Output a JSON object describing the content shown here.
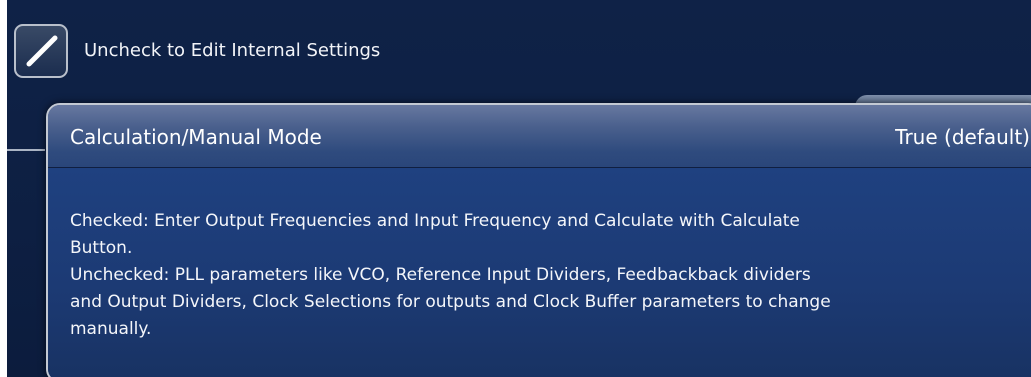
{
  "settings": {
    "lock_checkbox_label": "Uncheck to Edit Internal Settings",
    "lock_checked": true
  },
  "tooltip": {
    "title": "Calculation/Manual Mode",
    "value": "True (default)",
    "description_lines": [
      "Checked: Enter Output Frequencies and Input Frequency and Calculate with Calculate",
      "Button.",
      "Unchecked: PLL parameters like VCO, Reference Input Dividers, Feedbackback dividers",
      "and Output Dividers, Clock Selections for outputs and Clock Buffer parameters to change",
      "manually."
    ]
  },
  "colors": {
    "background": "#0f2247",
    "tooltip_body": "#1d3b74",
    "tooltip_header": "#4a608d",
    "text": "#ffffff"
  }
}
